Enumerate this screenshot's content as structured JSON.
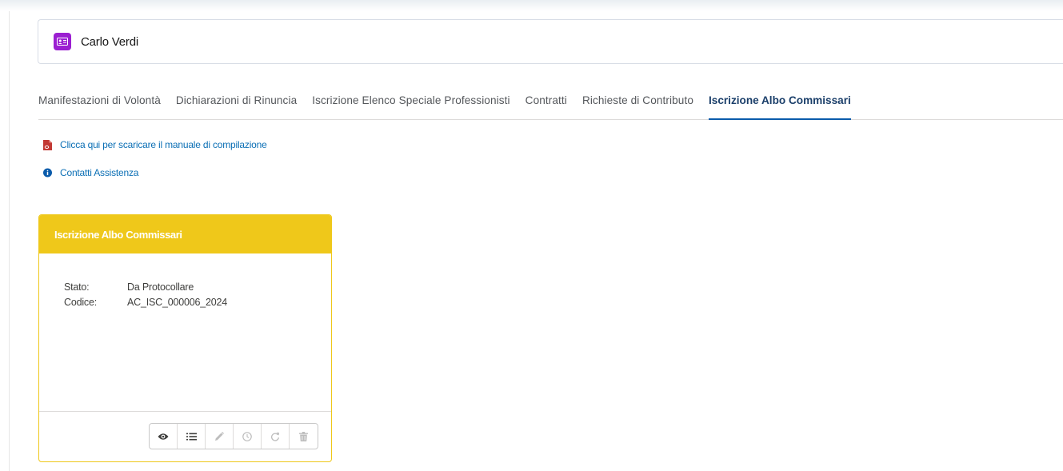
{
  "record": {
    "name": "Carlo Verdi",
    "icon": "contact-card-icon",
    "icon_color": "#9b1fd1"
  },
  "tabs": [
    {
      "label": "Manifestazioni di Volontà",
      "active": false
    },
    {
      "label": "Dichiarazioni di Rinuncia",
      "active": false
    },
    {
      "label": "Iscrizione Elenco Speciale Professionisti",
      "active": false
    },
    {
      "label": "Contratti",
      "active": false
    },
    {
      "label": "Richieste di Contributo",
      "active": false
    },
    {
      "label": "Iscrizione Albo Commissari",
      "active": true
    }
  ],
  "links": {
    "manual": {
      "label": "Clicca qui per scaricare il manuale di compilazione",
      "icon": "pdf-icon",
      "icon_color": "#c23934"
    },
    "support": {
      "label": "Contatti Assistenza",
      "icon": "info-icon",
      "icon_color": "#0b5cab"
    }
  },
  "card": {
    "title": "Iscrizione Albo Commissari",
    "header_color": "#efc81a",
    "fields": [
      {
        "label": "Stato:",
        "value": "Da Protocollare"
      },
      {
        "label": "Codice:",
        "value": "AC_ISC_000006_2024"
      }
    ],
    "actions": [
      {
        "icon": "eye-icon",
        "enabled": true
      },
      {
        "icon": "list-icon",
        "enabled": true
      },
      {
        "icon": "pencil-icon",
        "enabled": false
      },
      {
        "icon": "clock-icon",
        "enabled": false
      },
      {
        "icon": "redo-icon",
        "enabled": false
      },
      {
        "icon": "trash-icon",
        "enabled": false
      }
    ]
  },
  "colors": {
    "link": "#0b6fb5",
    "active_tab": "#1b3f6a",
    "tab_underline": "#0b5cab"
  }
}
